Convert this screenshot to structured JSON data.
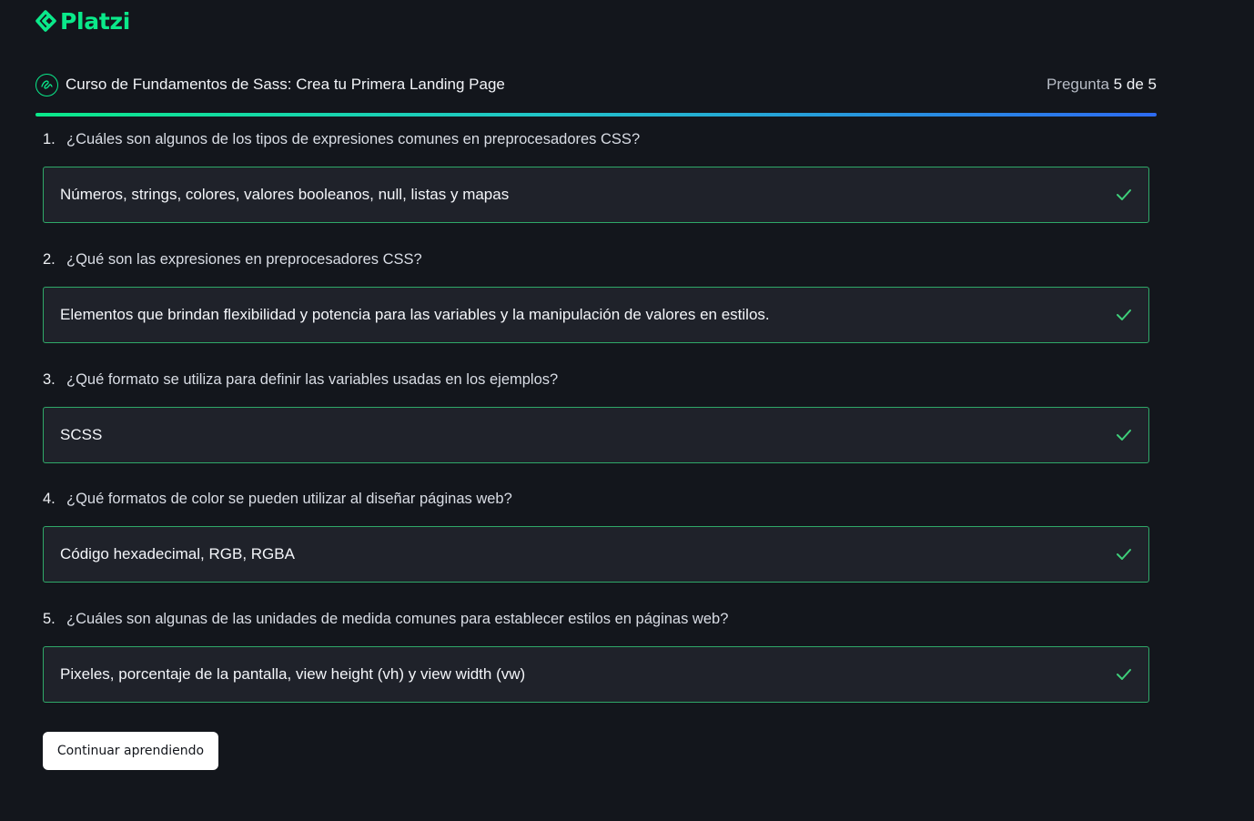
{
  "brand": {
    "name": "Platzi",
    "color": "#0ae98a"
  },
  "header": {
    "course_icon": "sass-logo-icon",
    "course_title": "Curso de Fundamentos de Sass: Crea tu Primera Landing Page",
    "counter_label": "Pregunta",
    "counter_current": "5",
    "counter_sep": "de",
    "counter_total": "5"
  },
  "progress": {
    "fraction": 1.0
  },
  "questions": [
    {
      "number": "1.",
      "text": "¿Cuáles son algunos de los tipos de expresiones comunes en preprocesadores CSS?",
      "answer": "Números, strings, colores, valores booleanos, null, listas y mapas"
    },
    {
      "number": "2.",
      "text": "¿Qué son las expresiones en preprocesadores CSS?",
      "answer": "Elementos que brindan flexibilidad y potencia para las variables y la manipulación de valores en estilos."
    },
    {
      "number": "3.",
      "text": "¿Qué formato se utiliza para definir las variables usadas en los ejemplos?",
      "answer": "SCSS"
    },
    {
      "number": "4.",
      "text": "¿Qué formatos de color se pueden utilizar al diseñar páginas web?",
      "answer": "Código hexadecimal, RGB, RGBA"
    },
    {
      "number": "5.",
      "text": "¿Cuáles son algunas de las unidades de medida comunes para establecer estilos en páginas web?",
      "answer": "Pixeles, porcentaje de la pantalla, view height (vh) y view width (vw)"
    }
  ],
  "icons": {
    "correct": "check-icon"
  },
  "colors": {
    "background": "#13161c",
    "answer_bg": "#1f222a",
    "answer_border": "#2fa868",
    "check": "#3ecf7a",
    "progress_start": "#0ae98a",
    "progress_end": "#2d6bf2"
  },
  "actions": {
    "continue_label": "Continuar aprendiendo"
  }
}
